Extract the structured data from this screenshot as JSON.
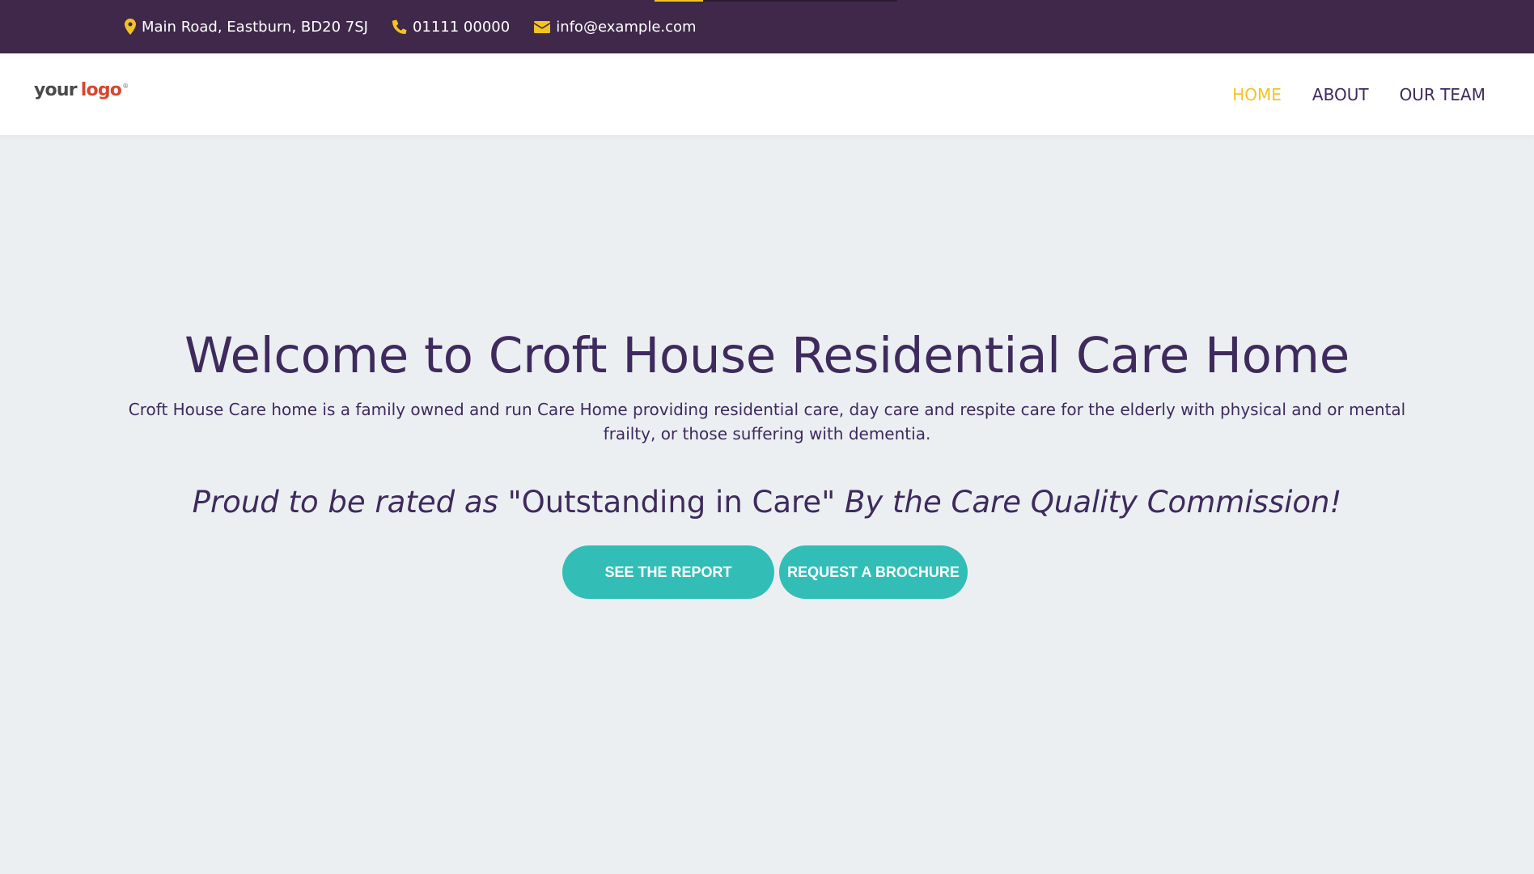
{
  "topbar": {
    "address": "Main Road, Eastburn, BD20 7SJ",
    "phone": "01111 00000",
    "email": "info@example.com",
    "icons": [
      "map-pin-icon",
      "phone-icon",
      "envelope-icon"
    ],
    "progress_fraction": 0.2
  },
  "header": {
    "logo_word1": "your",
    "logo_word2": "logo",
    "logo_mark": "®",
    "nav": [
      {
        "label": "HOME",
        "active": true
      },
      {
        "label": "ABOUT",
        "active": false
      },
      {
        "label": "OUR TEAM",
        "active": false
      }
    ]
  },
  "hero": {
    "title": "Welcome to Croft House Residential Care Home",
    "description": "Croft House Care home is a family owned and run Care Home providing residential care, day care and respite care for the elderly with physical and or mental frailty, or those suffering with dementia.",
    "rated_prefix": "Proud to be rated as",
    "rated_quote": "\"Outstanding in Care\"",
    "rated_suffix": "By the Care Quality Commission!",
    "buttons": {
      "report": "SEE THE REPORT",
      "brochure": "REQUEST A BROCHURE"
    }
  },
  "colors": {
    "topbar_bg": "#40284b",
    "accent_yellow": "#f3c322",
    "text_purple": "#3e2a5c",
    "button_teal": "#33bdb7",
    "page_bg": "#eceff2",
    "logo_red": "#d8472f"
  }
}
